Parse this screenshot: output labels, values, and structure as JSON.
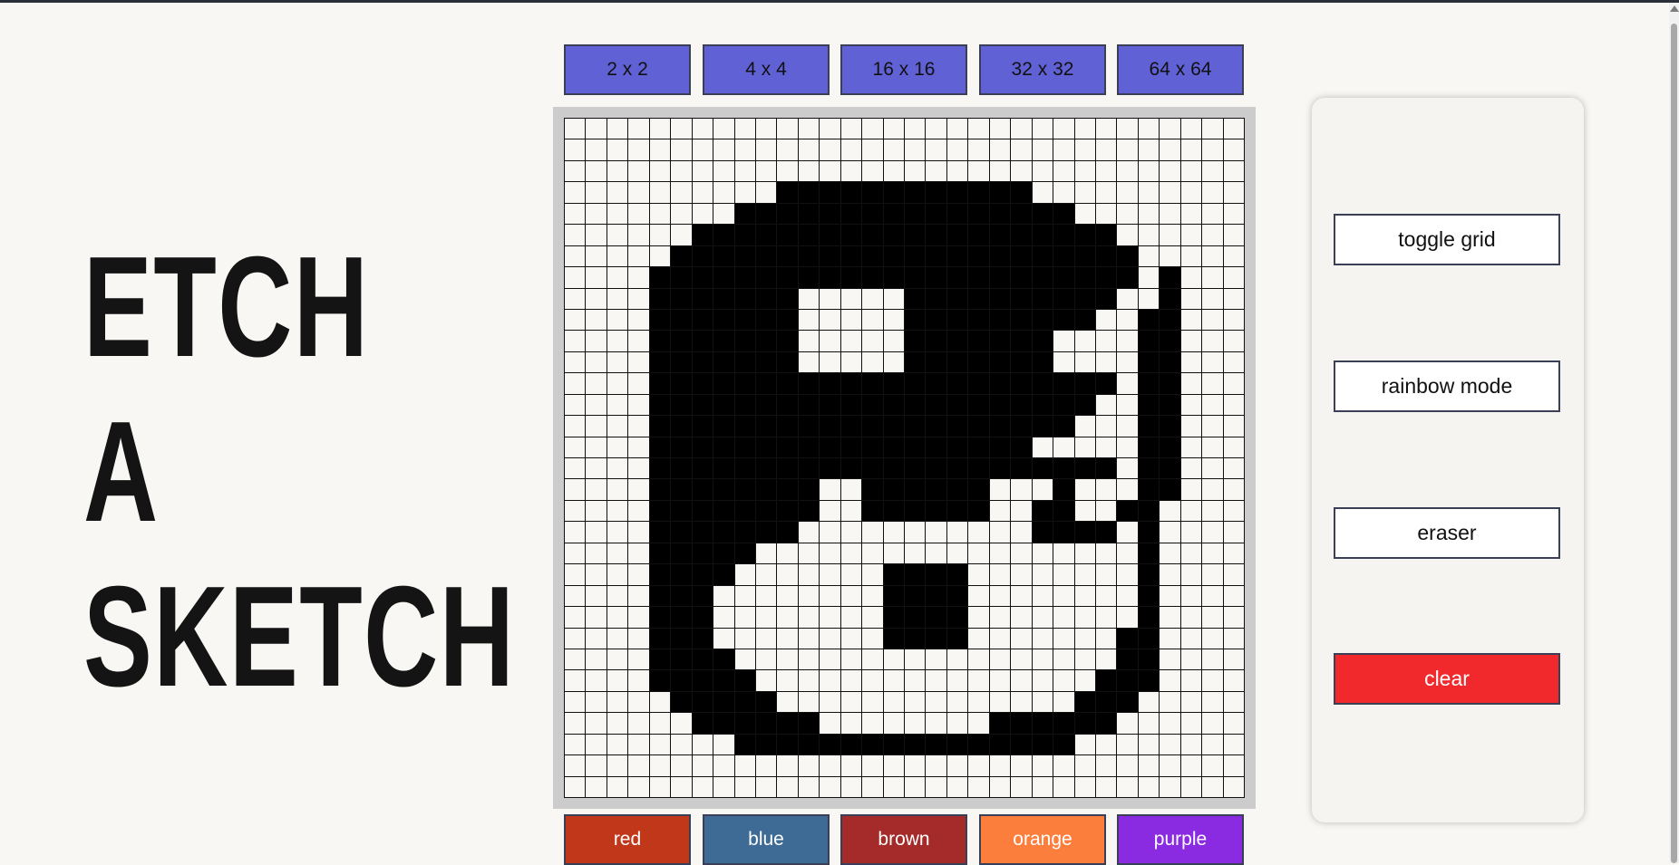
{
  "title": {
    "line1": "ETCH",
    "line2": "A",
    "line3": "SKETCH"
  },
  "grid_sizes": [
    {
      "label": "2 x 2"
    },
    {
      "label": "4 x 4"
    },
    {
      "label": "16 x 16"
    },
    {
      "label": "32 x 32"
    },
    {
      "label": "64 x 64"
    }
  ],
  "colors": [
    {
      "label": "red",
      "hex": "#c0371a"
    },
    {
      "label": "blue",
      "hex": "#3e6b96"
    },
    {
      "label": "brown",
      "hex": "#a52a2a"
    },
    {
      "label": "orange",
      "hex": "#fb7e3d"
    },
    {
      "label": "purple",
      "hex": "#8a2be2"
    }
  ],
  "controls": {
    "toggle_grid": "toggle grid",
    "rainbow_mode": "rainbow mode",
    "eraser": "eraser",
    "clear": "clear"
  },
  "canvas": {
    "grid_size": 32,
    "filled_rows": [
      "................................",
      "................................",
      "................................",
      "..........############..........",
      "........################........",
      "......####################......",
      ".....######################.....",
      "....#######################.#...",
      "....#######.....##########..#...",
      "....#######.....#########..##...",
      "....#######.....#######....##...",
      "....#######.....#######....##...",
      "....######################.##...",
      "....#####################..##...",
      "....####################...##...",
      "....##################.....##...",
      "....######################.##...",
      "....########..######...#...##...",
      "....########..######..##..##....",
      "....#######...........####.#....",
      "....#####..................#....",
      "....####.......####........#....",
      "....###........####........#....",
      "....###........####........#....",
      "....###........####.......##....",
      "....####..................##....",
      "....#####................###....",
      ".....#####..............###.....",
      "......######........######......",
      "........################........",
      "................................",
      "................................"
    ]
  }
}
